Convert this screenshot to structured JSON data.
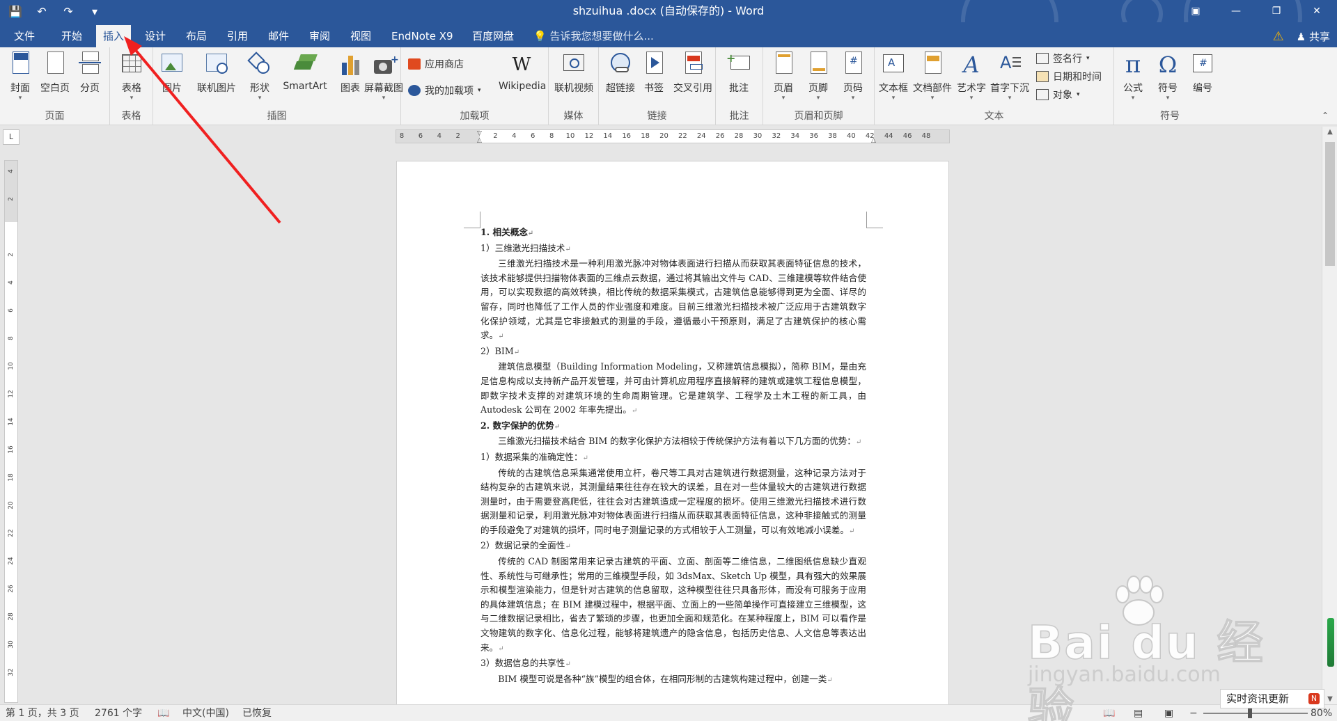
{
  "window": {
    "title": "shzuihua .docx (自动保存的) - Word",
    "qat": [
      "save-icon",
      "undo-icon",
      "redo-icon",
      "customize-icon"
    ],
    "buttons": [
      "ribbon-display-icon",
      "minimize-icon",
      "restore-icon",
      "close-icon"
    ]
  },
  "tabs": [
    {
      "label": "文件",
      "active": false
    },
    {
      "label": "开始",
      "active": false
    },
    {
      "label": "插入",
      "active": true
    },
    {
      "label": "设计",
      "active": false
    },
    {
      "label": "布局",
      "active": false
    },
    {
      "label": "引用",
      "active": false
    },
    {
      "label": "邮件",
      "active": false
    },
    {
      "label": "审阅",
      "active": false
    },
    {
      "label": "视图",
      "active": false
    },
    {
      "label": "EndNote X9",
      "active": false
    },
    {
      "label": "百度网盘",
      "active": false
    }
  ],
  "tellme": "告诉我您想要做什么...",
  "share": "共享",
  "ribbon": {
    "groups": [
      "页面",
      "表格",
      "插图",
      "加载项",
      "媒体",
      "链接",
      "批注",
      "页眉和页脚",
      "文本",
      "符号"
    ],
    "buttons": {
      "cover": "封面",
      "blank": "空白页",
      "pagebreak": "分页",
      "table": "表格",
      "picture": "图片",
      "online_picture": "联机图片",
      "shapes": "形状",
      "smartart": "SmartArt",
      "chart": "图表",
      "screenshot": "屏幕截图",
      "store": "应用商店",
      "my_addins": "我的加载项",
      "wikipedia": "Wikipedia",
      "online_video": "联机视频",
      "hyperlink": "超链接",
      "bookmark": "书签",
      "crossref": "交叉引用",
      "comment": "批注",
      "header": "页眉",
      "footer": "页脚",
      "pagenumber": "页码",
      "textbox": "文本框",
      "quickparts": "文档部件",
      "wordart": "艺术字",
      "dropcap": "首字下沉",
      "signature": "签名行",
      "datetime": "日期和时间",
      "object": "对象",
      "equation": "公式",
      "symbol": "符号",
      "number": "编号"
    }
  },
  "ruler": {
    "corner": "L",
    "h_ticks": [
      "8",
      "6",
      "4",
      "2",
      "",
      "2",
      "4",
      "6",
      "8",
      "10",
      "12",
      "14",
      "16",
      "18",
      "20",
      "22",
      "24",
      "26",
      "28",
      "30",
      "32",
      "34",
      "36",
      "38",
      "40",
      "42",
      "44",
      "46",
      "48"
    ],
    "v_ticks": [
      "4",
      "2",
      "",
      "2",
      "4",
      "6",
      "8",
      "10",
      "12",
      "14",
      "16",
      "18",
      "20",
      "22",
      "24",
      "26",
      "28",
      "30",
      "32"
    ]
  },
  "document": {
    "blocks": [
      {
        "type": "h",
        "text": "1. 相关概念"
      },
      {
        "type": "l",
        "text": "1）三维激光扫描技术"
      },
      {
        "type": "p",
        "text": "三维激光扫描技术是一种利用激光脉冲对物体表面进行扫描从而获取其表面特征信息的技术，该技术能够提供扫描物体表面的三维点云数据，通过将其输出文件与 CAD、三维建模等软件结合使用，可以实现数据的高效转换，相比传统的数据采集模式，古建筑信息能够得到更为全面、详尽的留存，同时也降低了工作人员的作业强度和难度。目前三维激光扫描技术被广泛应用于古建筑数字化保护领域，尤其是它非接触式的测量的手段，遵循最小干预原则，满足了古建筑保护的核心需求。"
      },
      {
        "type": "l",
        "text": "2）BIM"
      },
      {
        "type": "p",
        "text": "建筑信息模型（Building Information Modeling，又称建筑信息模拟），简称 BIM，是由充足信息构成以支持新产品开发管理，并可由计算机应用程序直接解释的建筑或建筑工程信息模型，即数字技术支撑的对建筑环境的生命周期管理。它是建筑学、工程学及土木工程的新工具，由 Autodesk 公司在 2002 年率先提出。"
      },
      {
        "type": "h",
        "text": "2. 数字保护的优势"
      },
      {
        "type": "p",
        "text": "三维激光扫描技术结合 BIM 的数字化保护方法相较于传统保护方法有着以下几方面的优势："
      },
      {
        "type": "l",
        "text": "1）数据采集的准确定性："
      },
      {
        "type": "p",
        "text": "传统的古建筑信息采集通常使用立杆，卷尺等工具对古建筑进行数据测量，这种记录方法对于结构复杂的古建筑来说，其测量结果往往存在较大的误差，且在对一些体量较大的古建筑进行数据测量时，由于需要登高爬低，往往会对古建筑造成一定程度的损坏。使用三维激光扫描技术进行数据测量和记录，利用激光脉冲对物体表面进行扫描从而获取其表面特征信息，这种非接触式的测量的手段避免了对建筑的损坏，同时电子测量记录的方式相较于人工测量，可以有效地减小误差。"
      },
      {
        "type": "l",
        "text": "2）数据记录的全面性"
      },
      {
        "type": "p",
        "text": "传统的 CAD 制图常用来记录古建筑的平面、立面、剖面等二维信息，二维图纸信息缺少直观性、系统性与可继承性；常用的三维模型手段，如 3dsMax、Sketch Up 模型，具有强大的效果展示和模型渲染能力，但是针对古建筑的信息留取，这种模型往往只具备形体，而没有可服务于应用的具体建筑信息；在 BIM 建模过程中，根据平面、立面上的一些简单操作可直接建立三维模型，这与二维数据记录相比，省去了繁琐的步骤，也更加全面和规范化。在某种程度上，BIM 可以看作是文物建筑的数字化、信息化过程，能够将建筑遗产的隐含信息，包括历史信息、人文信息等表达出来。"
      },
      {
        "type": "l",
        "text": "3）数据信息的共享性"
      },
      {
        "type": "p",
        "text": "BIM 模型可说是各种“族”模型的组合体，在相同形制的古建筑构建过程中，创建一类"
      }
    ]
  },
  "status": {
    "page": "第 1 页，共 3 页",
    "words": "2761 个字",
    "lang": "中文(中国)",
    "recovered": "已恢复",
    "zoom": "80%"
  },
  "watermark": {
    "brand": "Bai du 经验",
    "url": "jingyan.baidu.com"
  },
  "popup": {
    "text": "实时资讯更新",
    "badge": "N"
  },
  "colors": {
    "accent": "#2b579a",
    "annotation": "#f02020"
  }
}
